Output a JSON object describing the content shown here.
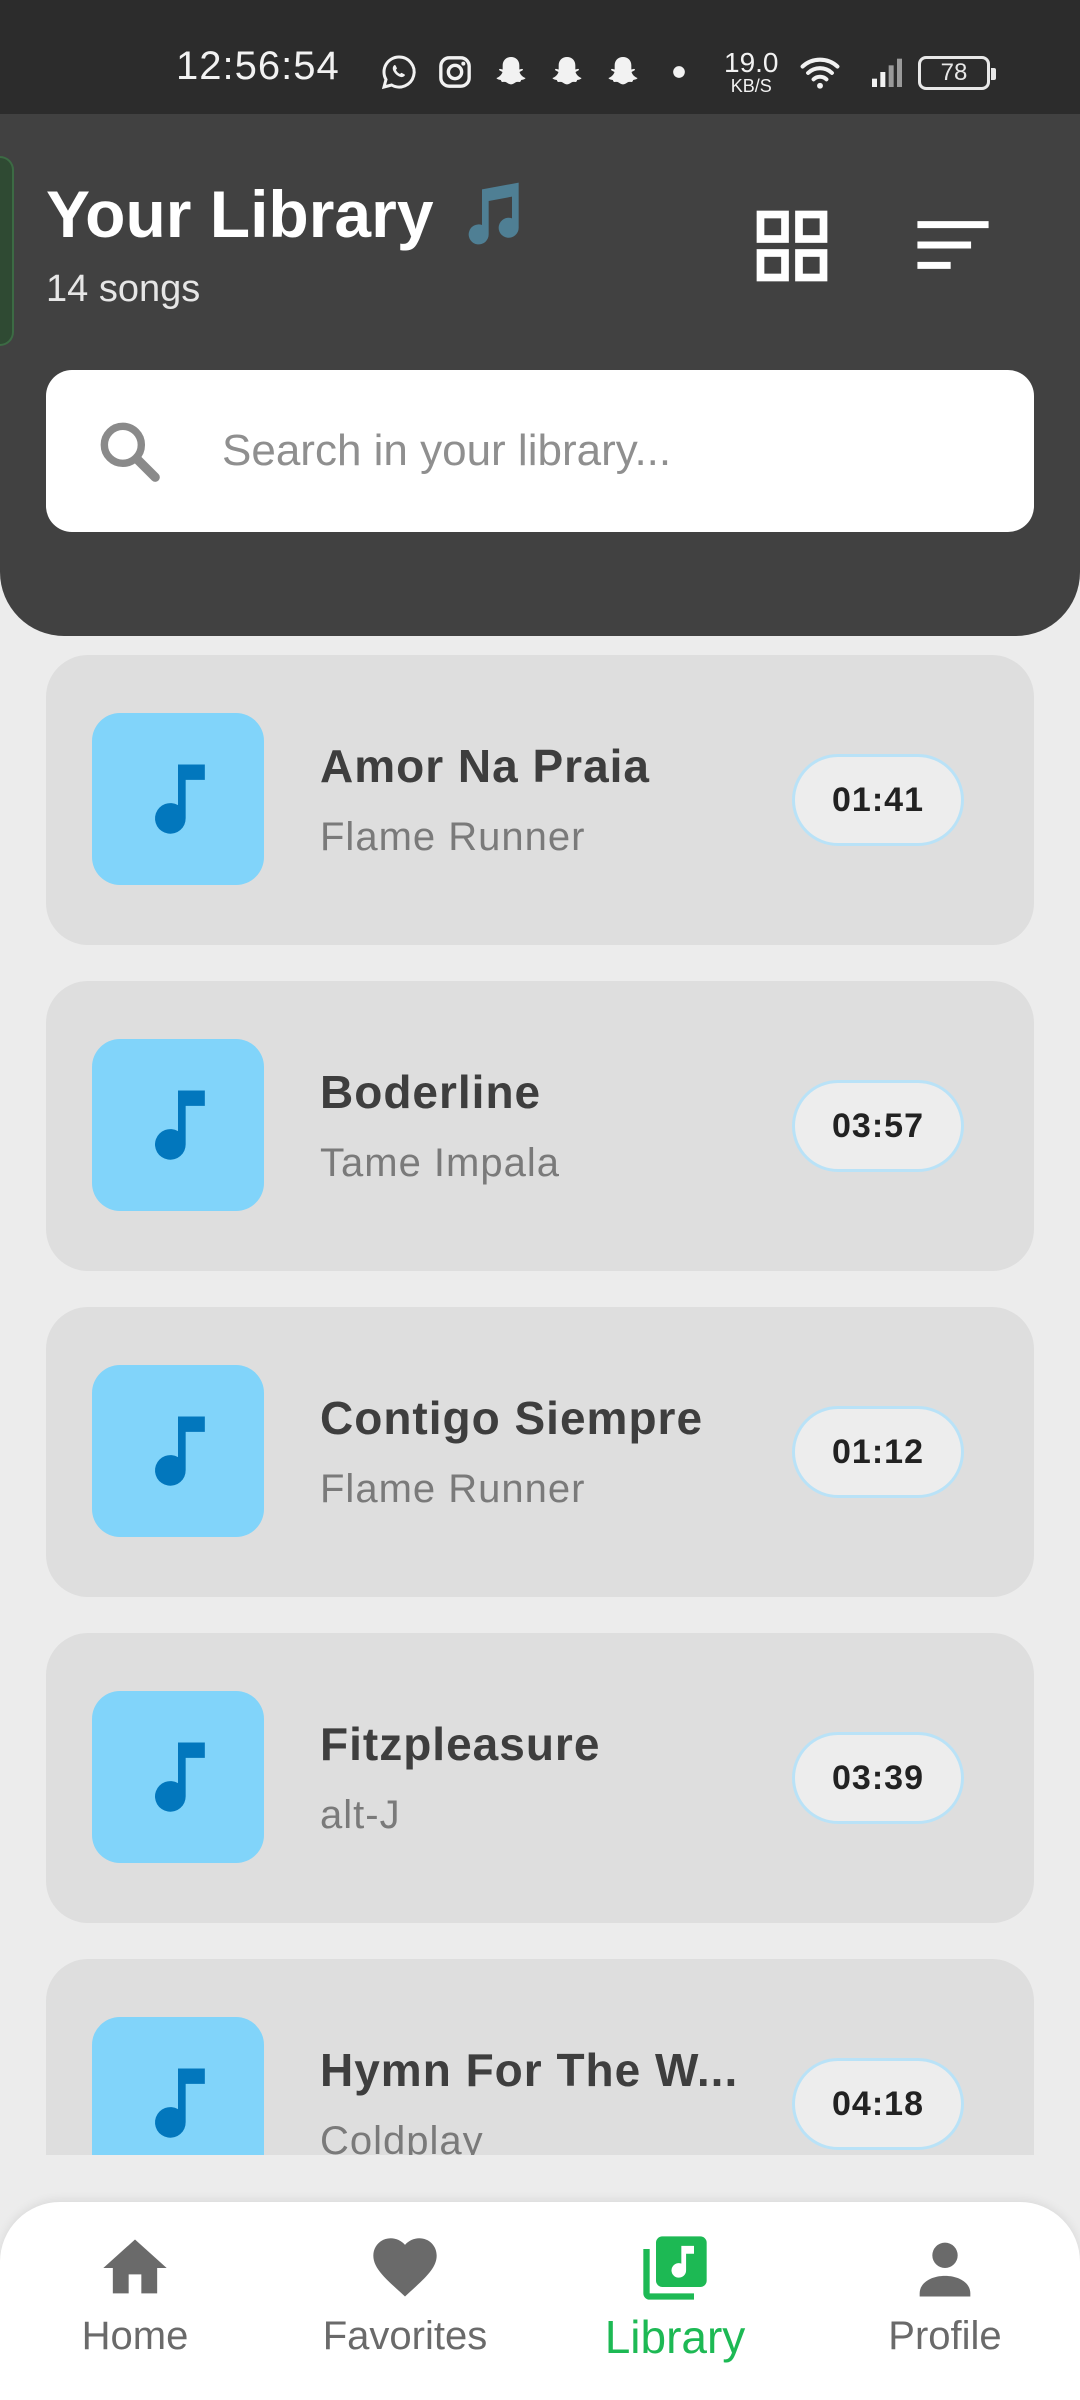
{
  "status_bar": {
    "time": "12:56:54",
    "net_speed_value": "19.0",
    "net_speed_unit": "KB/S",
    "battery": "78",
    "icons": [
      "whatsapp-icon",
      "instagram-icon",
      "snapchat-icon",
      "snapchat-icon",
      "snapchat-icon",
      "dot-icon",
      "wifi-icon",
      "signal-icon",
      "battery-icon"
    ]
  },
  "header": {
    "title": "Your Library",
    "title_emoji": "music-note-emoji",
    "song_count": "14 songs",
    "grid_view_icon": "grid-icon",
    "sort_icon": "sort-icon"
  },
  "search": {
    "placeholder": "Search in your library...",
    "value": ""
  },
  "songs": [
    {
      "title": "Amor Na Praia",
      "artist": "Flame Runner",
      "duration": "01:41"
    },
    {
      "title": "Boderline",
      "artist": "Tame Impala",
      "duration": "03:57"
    },
    {
      "title": "Contigo Siempre",
      "artist": "Flame Runner",
      "duration": "01:12"
    },
    {
      "title": "Fitzpleasure",
      "artist": "alt-J",
      "duration": "03:39"
    },
    {
      "title": "Hymn For The W...",
      "artist": "Coldplay",
      "duration": "04:18"
    }
  ],
  "bottom_nav": {
    "items": [
      {
        "label": "Home",
        "icon": "home-icon"
      },
      {
        "label": "Favorites",
        "icon": "heart-icon"
      },
      {
        "label": "Library",
        "icon": "library-music-icon"
      },
      {
        "label": "Profile",
        "icon": "person-icon"
      }
    ],
    "active": "Library"
  },
  "colors": {
    "accent": "#1db954",
    "header_bg": "#414141",
    "card_bg": "#dedede",
    "artwork_bg": "#81d4fa",
    "note_color": "#0277bd"
  }
}
